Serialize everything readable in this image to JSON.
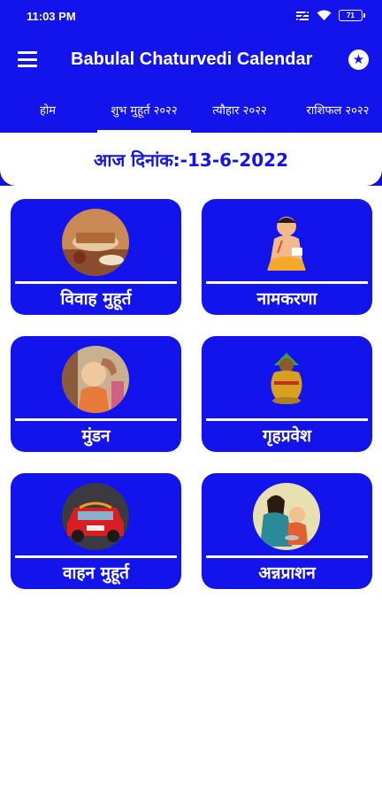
{
  "status_bar": {
    "time": "11:03 PM",
    "battery": "71"
  },
  "app_bar": {
    "title": "Babulal Chaturvedi Calendar",
    "menu_icon": "hamburger-menu-icon",
    "rate_icon": "star-circle-icon"
  },
  "tabs": [
    {
      "label": "होम"
    },
    {
      "label": "शुभ मुहूर्त २०२२",
      "selected": true
    },
    {
      "label": "त्यौहार २०२२"
    },
    {
      "label": "राशिफल २०२२"
    }
  ],
  "date_text": "आज दिनांक:-13-6-2022",
  "colors": {
    "primary": "#1313EC",
    "white": "#FFFFFF"
  },
  "tiles": [
    {
      "label": "विवाह मुहूर्त",
      "icon": "wedding-ritual-image"
    },
    {
      "label": "नामकरणा",
      "icon": "child-writing-image"
    },
    {
      "label": "मुंडन",
      "icon": "child-headshave-image"
    },
    {
      "label": "गृहप्रवेश",
      "icon": "kalash-image"
    },
    {
      "label": "वाहन मुहूर्त",
      "icon": "car-puja-image"
    },
    {
      "label": "अन्नप्राशन",
      "icon": "mother-feeding-child-image"
    }
  ]
}
